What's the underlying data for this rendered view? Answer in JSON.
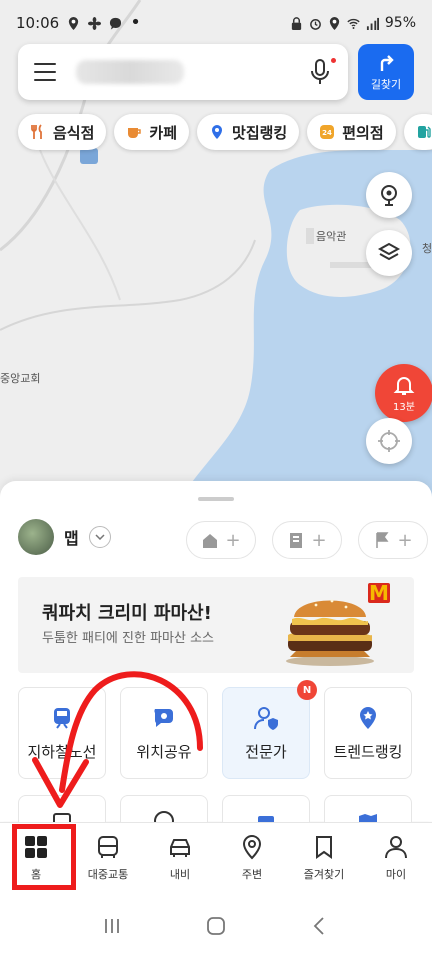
{
  "status_bar": {
    "time": "10:06",
    "battery": "95%",
    "left_icons": [
      "location-icon",
      "fan-icon",
      "chat-icon",
      "dot-icon"
    ],
    "right_icons": [
      "lock-icon",
      "alarm-icon",
      "location-icon",
      "wifi-icon",
      "signal-icon"
    ]
  },
  "search": {
    "menu_icon": "hamburger-icon",
    "mic_icon": "mic-icon",
    "route_label": "길찾기"
  },
  "chips": [
    {
      "label": "음식점",
      "icon": "fork-knife-icon",
      "color": "#e0743a"
    },
    {
      "label": "카페",
      "icon": "cup-icon",
      "color": "#e98b34"
    },
    {
      "label": "맛집랭킹",
      "icon": "ranking-pin-icon",
      "color": "#2f6fe8"
    },
    {
      "label": "편의점",
      "icon": "store-24-icon",
      "color": "#f0a52a"
    },
    {
      "label": "",
      "icon": "gas-icon",
      "color": "#22a3a0"
    }
  ],
  "map": {
    "labels": {
      "temple": "음악관",
      "church": "중앙교회",
      "cut": "청"
    },
    "alarm_label": "13분"
  },
  "sheet": {
    "profile_name": "맵",
    "shortcut_icons": [
      "home-icon",
      "office-icon",
      "flag-icon"
    ],
    "banner": {
      "title": "쿼파치 크리미 파마산!",
      "subtitle": "두툼한 패티에 진한 파마산 소스",
      "brand_mark": "M"
    },
    "tiles": [
      {
        "label": "지하철노선",
        "icon": "subway-icon",
        "highlight": false,
        "badge": ""
      },
      {
        "label": "위치공유",
        "icon": "share-location-icon",
        "highlight": false,
        "badge": ""
      },
      {
        "label": "전문가",
        "icon": "expert-icon",
        "highlight": true,
        "badge": "N"
      },
      {
        "label": "트렌드랭킹",
        "icon": "trend-pin-icon",
        "highlight": false,
        "badge": ""
      }
    ]
  },
  "bottom_nav": [
    {
      "label": "홈",
      "icon": "grid-home-icon",
      "active": true
    },
    {
      "label": "대중교통",
      "icon": "bus-icon",
      "active": false
    },
    {
      "label": "내비",
      "icon": "car-icon",
      "active": false
    },
    {
      "label": "주변",
      "icon": "pin-icon",
      "active": false
    },
    {
      "label": "즐겨찾기",
      "icon": "bookmark-icon",
      "active": false
    },
    {
      "label": "마이",
      "icon": "person-icon",
      "active": false
    }
  ],
  "system_nav": [
    "recent-apps-icon",
    "home-button-icon",
    "back-icon"
  ],
  "colors": {
    "accent": "#1a6bf0",
    "alert": "#f04637",
    "water": "#b9d4ee",
    "annotation": "#ee1c1c"
  }
}
